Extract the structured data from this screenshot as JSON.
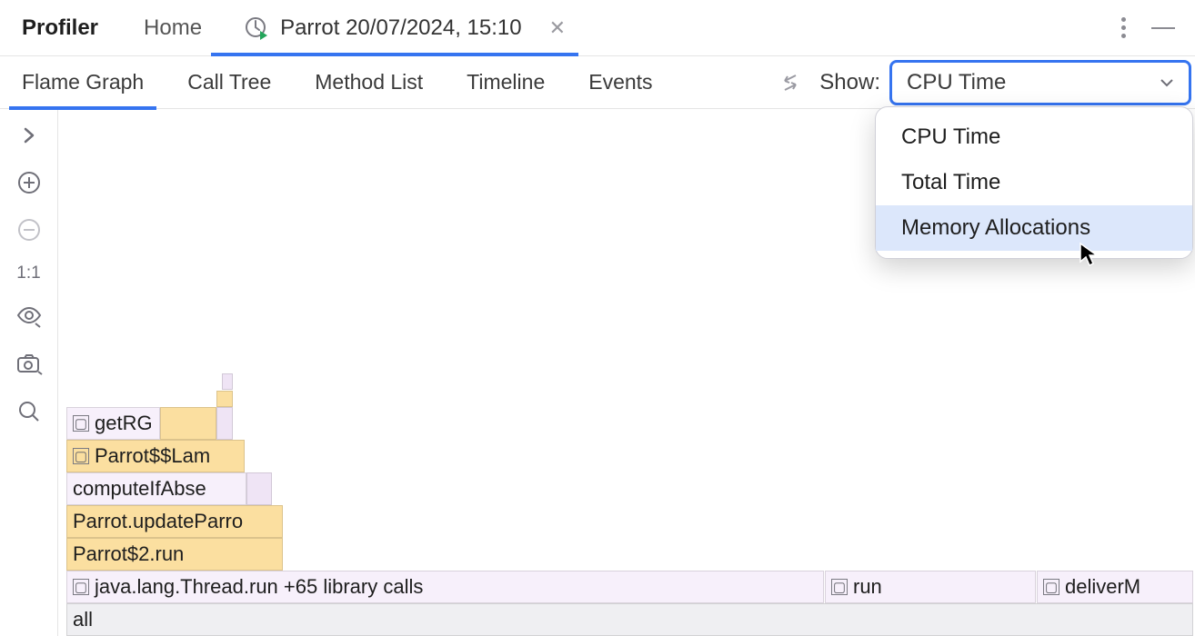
{
  "titlebar": {
    "title": "Profiler",
    "home": "Home",
    "session_label": "Parrot 20/07/2024, 15:10"
  },
  "views": {
    "tabs": [
      "Flame Graph",
      "Call Tree",
      "Method List",
      "Timeline",
      "Events"
    ],
    "show_label": "Show:",
    "show_selected": "CPU Time",
    "show_options": [
      "CPU Time",
      "Total Time",
      "Memory Allocations"
    ]
  },
  "sidebar": {
    "scale_label": "1:1"
  },
  "flame": {
    "rows": {
      "all": "all",
      "thread_run": "java.lang.Thread.run  +65 library calls",
      "run2": "run",
      "deliver": "deliverM",
      "parrot2run": "Parrot$2.run",
      "update": "Parrot.updateParro",
      "compute": "computeIfAbse",
      "lambda": "Parrot$$Lam",
      "getrg": "getRG"
    }
  }
}
